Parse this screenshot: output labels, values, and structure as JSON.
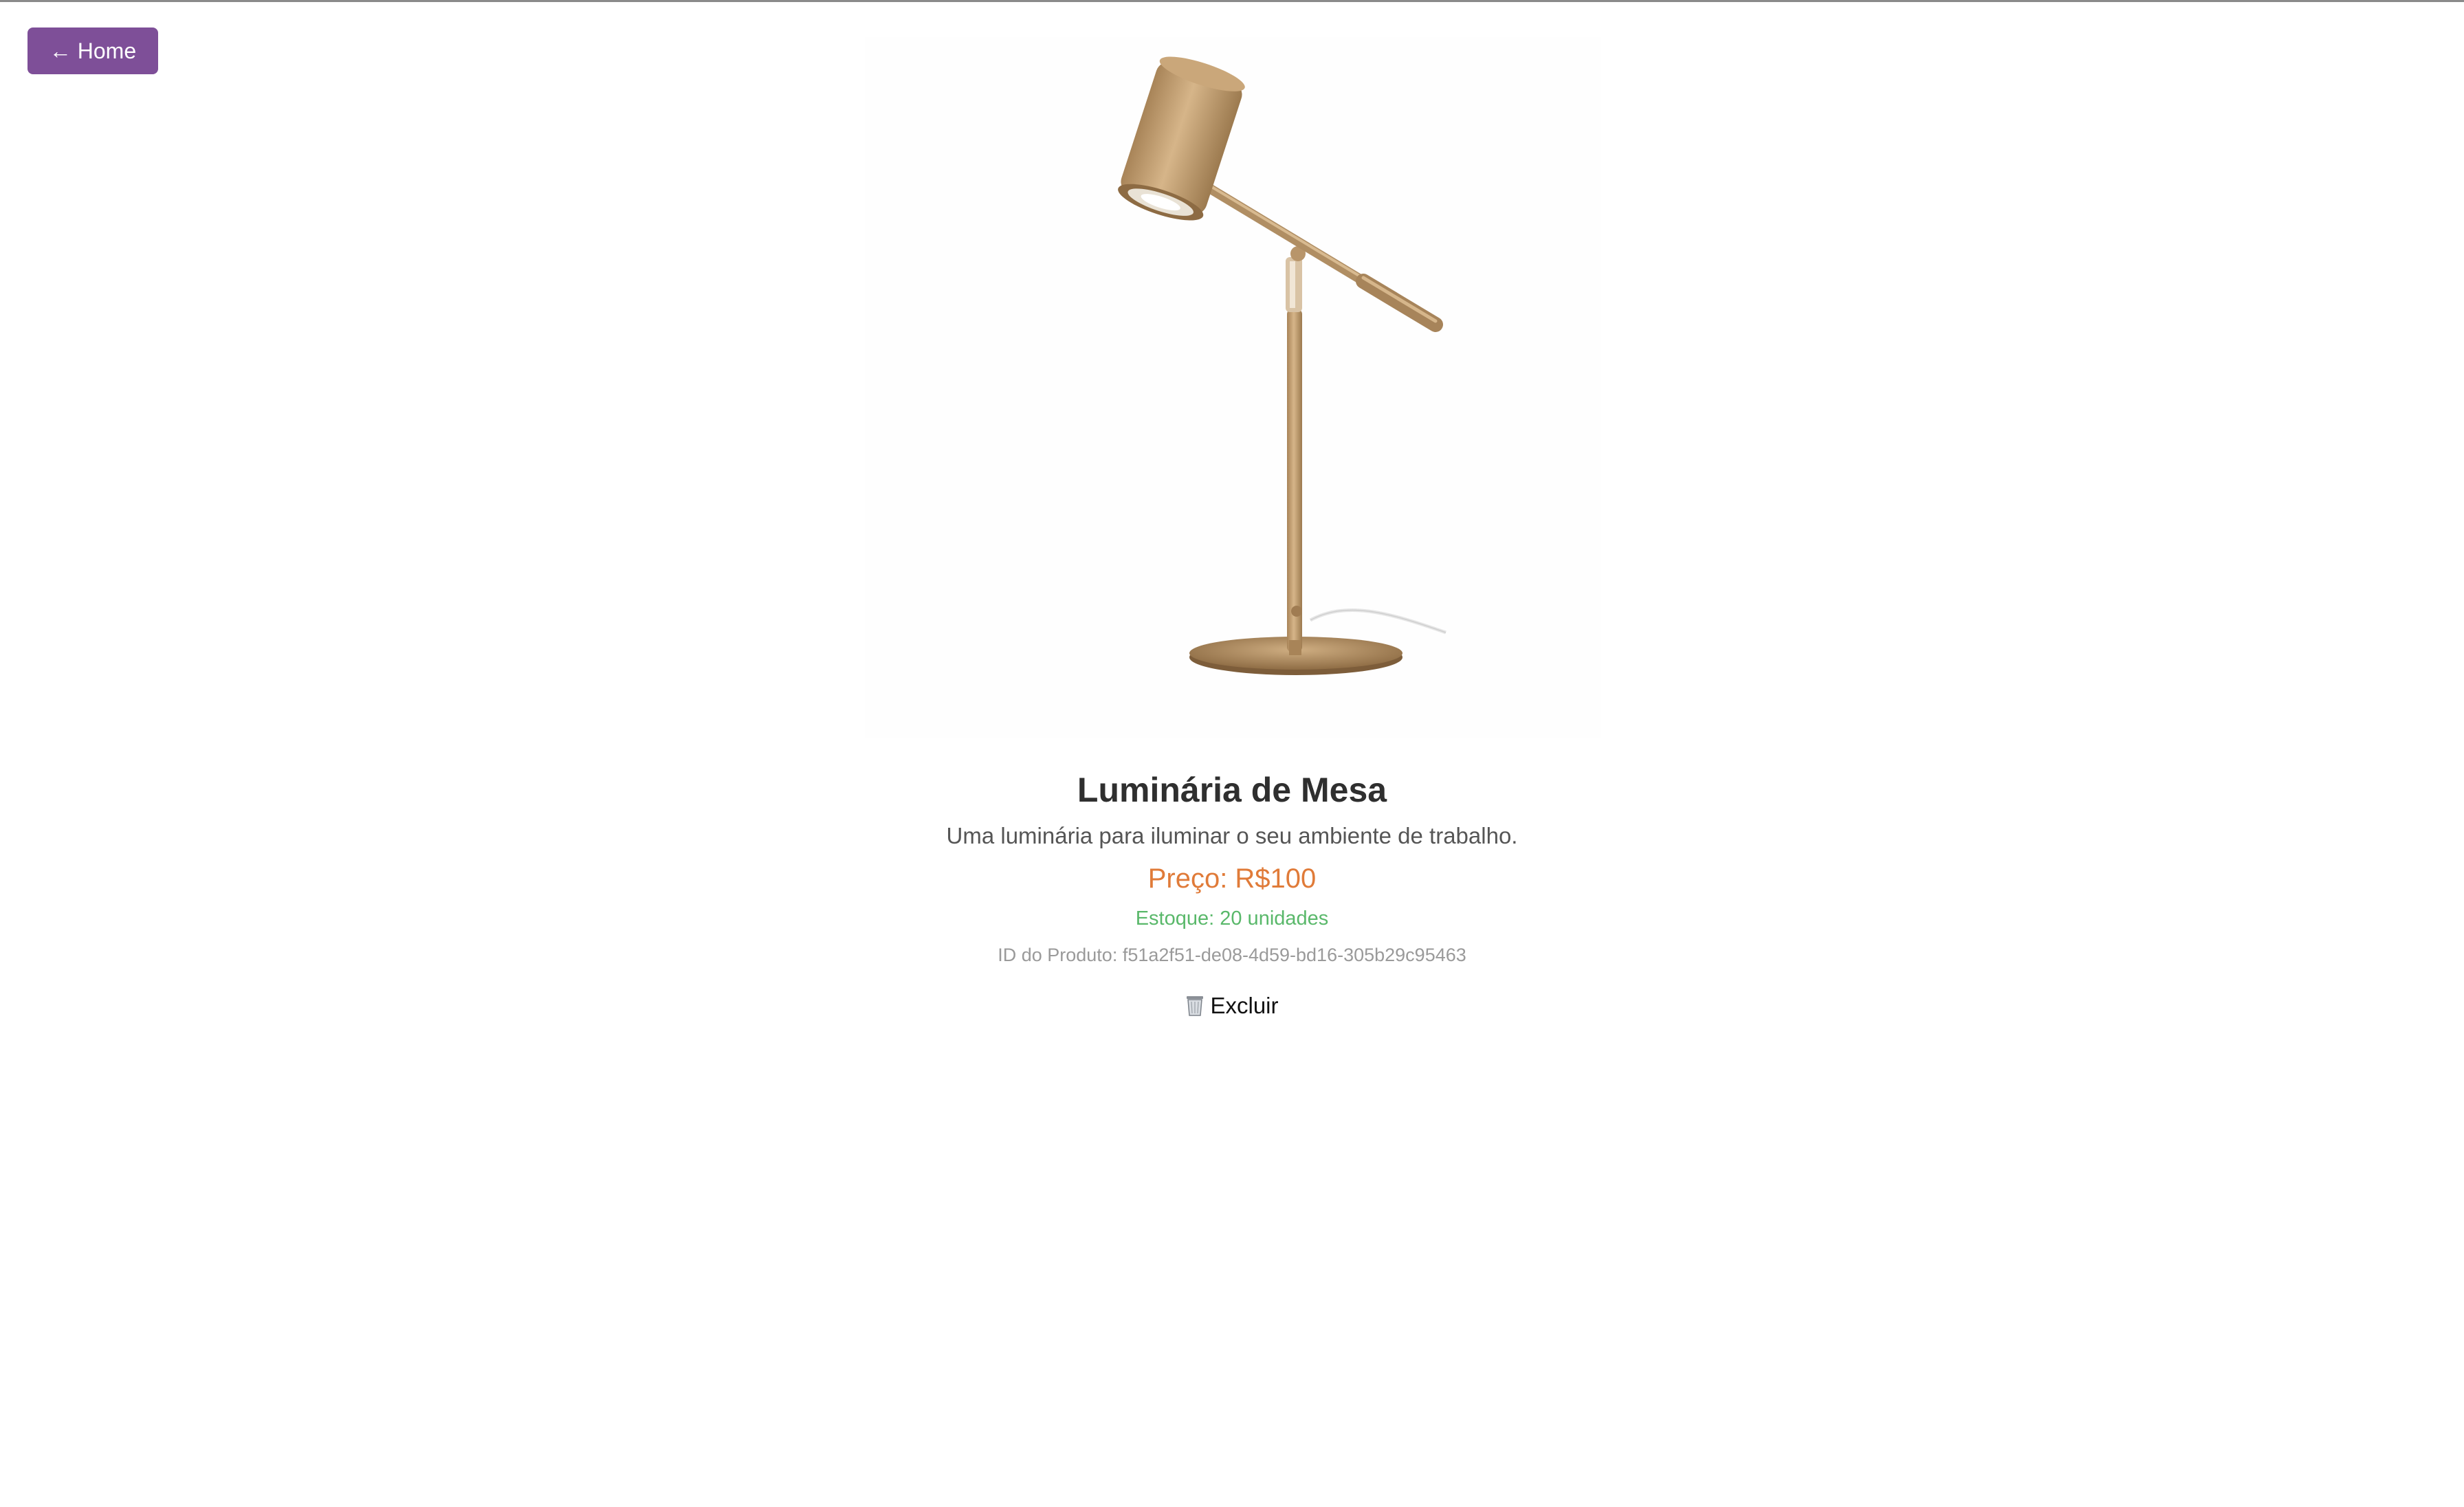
{
  "nav": {
    "home_label": "← Home"
  },
  "product": {
    "image_alt": "Luminária de Mesa",
    "title": "Luminária de Mesa",
    "description": "Uma luminária para iluminar o seu ambiente de trabalho.",
    "price": "Preço: R$100",
    "stock": "Estoque: 20 unidades",
    "id_text": "ID do Produto: f51a2f51-de08-4d59-bd16-305b29c95463"
  },
  "actions": {
    "delete_label": "Excluir",
    "delete_icon": "trash-icon"
  },
  "colors": {
    "home_button": "#7e4f98",
    "price": "#e07b39",
    "stock": "#59b86a",
    "product_id": "#9a9a9a",
    "title": "#2f2f2f"
  }
}
